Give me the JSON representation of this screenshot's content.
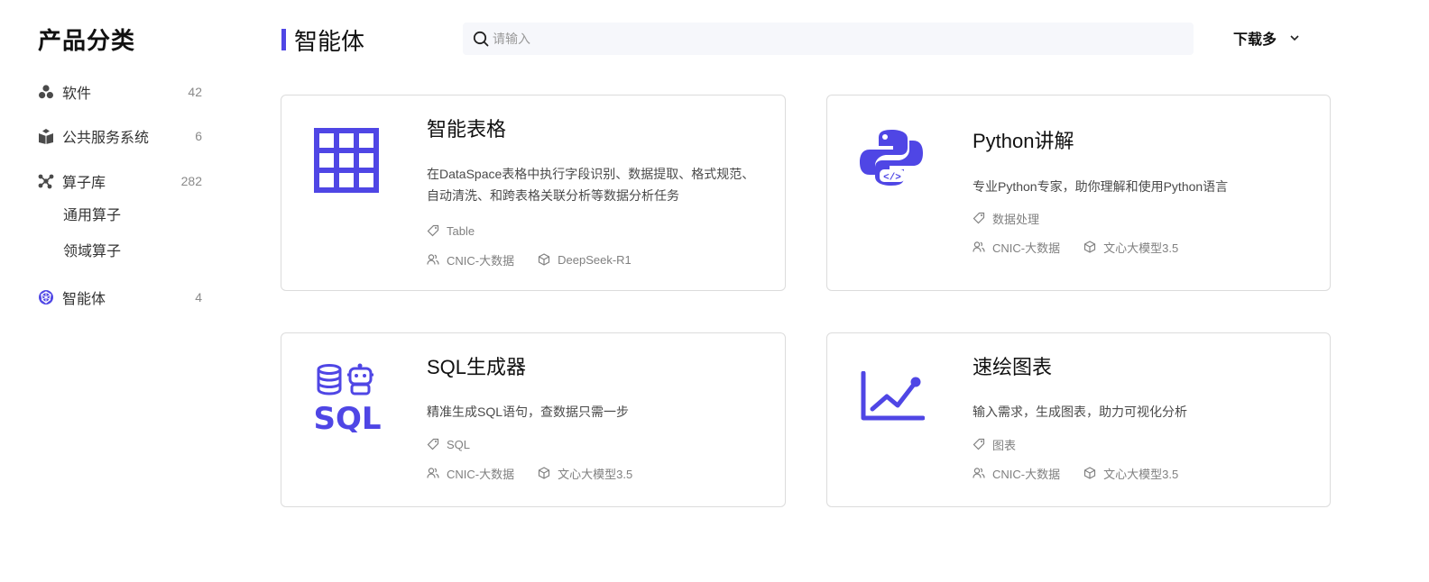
{
  "sidebar": {
    "title": "产品分类",
    "categories": [
      {
        "label": "软件",
        "count": "42",
        "icon": "software-icon"
      },
      {
        "label": "公共服务系统",
        "count": "6",
        "icon": "public-service-icon"
      },
      {
        "label": "算子库",
        "count": "282",
        "icon": "operator-library-icon"
      },
      {
        "label": "智能体",
        "count": "4",
        "icon": "agent-icon"
      }
    ],
    "subcategories": [
      "通用算子",
      "领域算子"
    ]
  },
  "header": {
    "title": "智能体",
    "search_placeholder": "请输入",
    "search_value": "",
    "sort_label": "下载多"
  },
  "cards": [
    {
      "title": "智能表格",
      "description": "在DataSpace表格中执行字段识别、数据提取、格式规范、自动清洗、和跨表格关联分析等数据分析任务",
      "tag": "Table",
      "provider": "CNIC-大数据",
      "model": "DeepSeek-R1",
      "logo": "table-grid-icon"
    },
    {
      "title": "Python讲解",
      "description": "专业Python专家，助你理解和使用Python语言",
      "tag": "数据处理",
      "provider": "CNIC-大数据",
      "model": "文心大模型3.5",
      "logo": "python-code-icon"
    },
    {
      "title": "SQL生成器",
      "description": "精准生成SQL语句，查数据只需一步",
      "tag": "SQL",
      "provider": "CNIC-大数据",
      "model": "文心大模型3.5",
      "logo": "sql-robot-icon",
      "logo_text": "SQL"
    },
    {
      "title": "速绘图表",
      "description": "输入需求，生成图表，助力可视化分析",
      "tag": "图表",
      "provider": "CNIC-大数据",
      "model": "文心大模型3.5",
      "logo": "line-chart-icon"
    }
  ],
  "colors": {
    "accent": "#4f46e5",
    "border": "#dcdcdc",
    "muted": "#808080",
    "search_bg": "#f6f7fb"
  }
}
